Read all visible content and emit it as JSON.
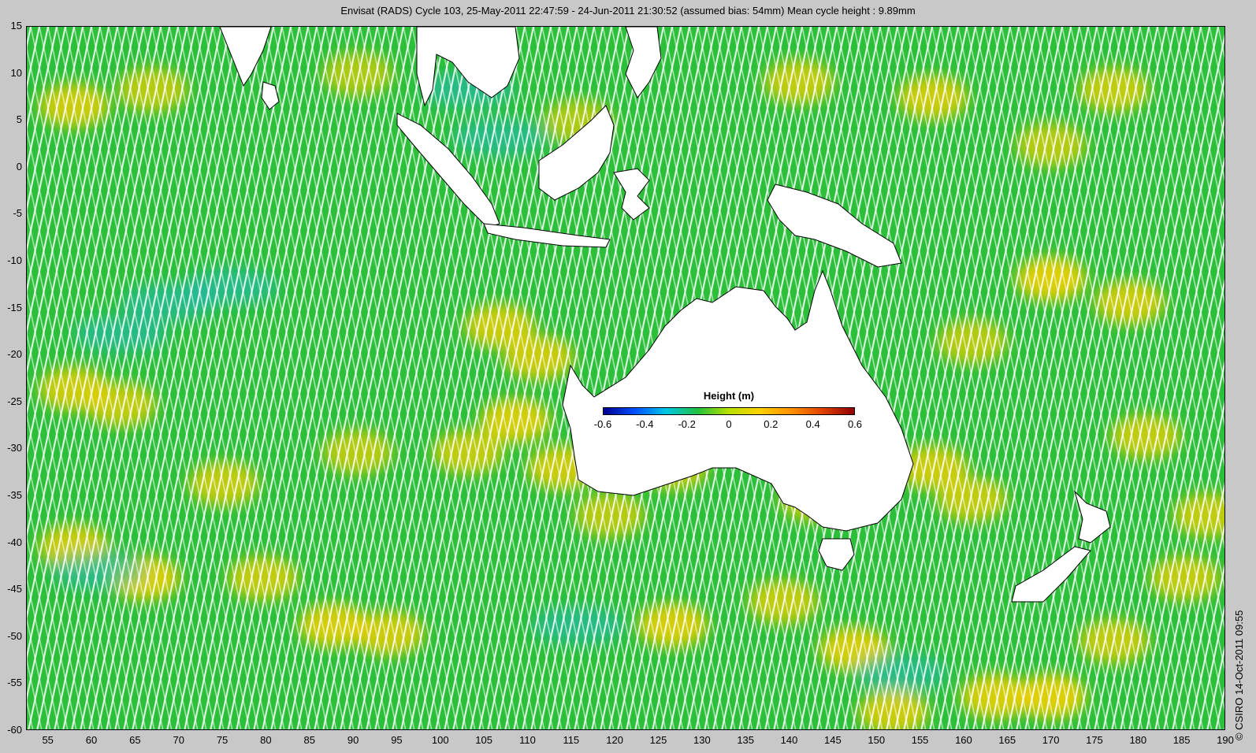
{
  "title": "Envisat (RADS) Cycle 103, 25-May-2011 22:47:59 - 24-Jun-2011 21:30:52 (assumed bias: 54mm)  Mean cycle height : 9.89mm",
  "credit": "© CSIRO 14-Oct-2011 09:55",
  "lat_ticks": [
    "15",
    "10",
    "5",
    "0",
    "-5",
    "-10",
    "-15",
    "-20",
    "-25",
    "-30",
    "-35",
    "-40",
    "-45",
    "-50",
    "-55",
    "-60"
  ],
  "lon_ticks": [
    "55",
    "60",
    "65",
    "70",
    "75",
    "80",
    "85",
    "90",
    "95",
    "100",
    "105",
    "110",
    "115",
    "120",
    "125",
    "130",
    "135",
    "140",
    "145",
    "150",
    "155",
    "160",
    "165",
    "170",
    "175",
    "180",
    "185",
    "190"
  ],
  "colorbar": {
    "title": "Height (m)",
    "ticks": [
      "-0.6",
      "-0.4",
      "-0.2",
      "0",
      "0.2",
      "0.4",
      "0.6"
    ],
    "colors": [
      "#00008f",
      "#0050ff",
      "#00c8e6",
      "#20c040",
      "#b8e000",
      "#ffd000",
      "#ff9000",
      "#e04000",
      "#900000"
    ]
  },
  "map": {
    "lon_range": [
      52.5,
      190
    ],
    "lat_range": [
      -60,
      15
    ],
    "colors": {
      "land": "#ffffff",
      "ocean_base": "#2bbf3a",
      "high_anomaly": "#f0d000",
      "low_anomaly": "#20b8c0"
    },
    "land_labels": [
      "Australia",
      "India",
      "Sri Lanka",
      "Indochina",
      "Sumatra",
      "Borneo",
      "Sulawesi",
      "New Guinea",
      "New Zealand",
      "Tasmania",
      "Philippines"
    ]
  }
}
